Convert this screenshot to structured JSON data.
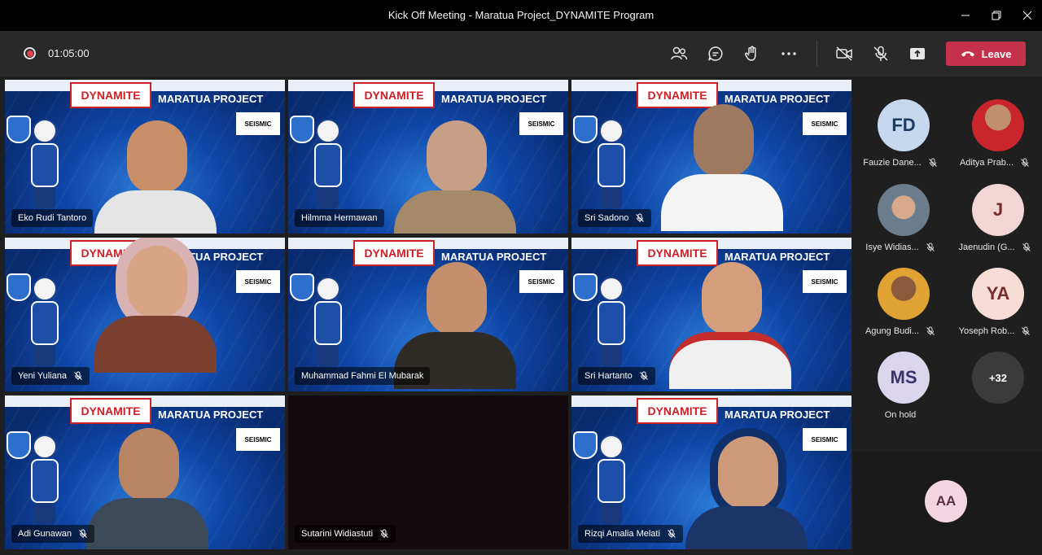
{
  "window": {
    "title": "Kick Off Meeting - Maratua Project_DYNAMITE Program"
  },
  "toolbar": {
    "timer": "01:05:00",
    "leave_label": "Leave"
  },
  "background": {
    "dynamite": "DYNAMITE",
    "project": "MARATUA PROJECT",
    "seismic": "SEISMIC"
  },
  "participants": [
    {
      "name": "Eko Rudi Tantoro",
      "muted": false
    },
    {
      "name": "Hilmma Hermawan",
      "muted": false
    },
    {
      "name": "Sri Sadono",
      "muted": true
    },
    {
      "name": "Yeni Yuliana",
      "muted": true
    },
    {
      "name": "Muhammad Fahmi El Mubarak",
      "muted": false,
      "active": true
    },
    {
      "name": "Sri Hartanto",
      "muted": true
    },
    {
      "name": "Adi Gunawan",
      "muted": true
    },
    {
      "name": "Sutarini Widiastuti",
      "muted": true,
      "video_off": true
    },
    {
      "name": "Rizqi Amalia Melati",
      "muted": true
    }
  ],
  "sidebar": {
    "people": [
      {
        "initials": "FD",
        "name": "Fauzie Dane...",
        "muted": true
      },
      {
        "initials": "",
        "name": "Aditya Prab...",
        "muted": true
      },
      {
        "initials": "",
        "name": "Isye Widias...",
        "muted": true
      },
      {
        "initials": "J",
        "name": "Jaenudin (G...",
        "muted": true
      },
      {
        "initials": "",
        "name": "Agung Budi...",
        "muted": true
      },
      {
        "initials": "YA",
        "name": "Yoseph Rob...",
        "muted": true
      },
      {
        "initials": "MS",
        "name": "On hold",
        "muted": false
      },
      {
        "initials": "+32",
        "name": "",
        "muted": false
      }
    ],
    "self_initials": "AA"
  },
  "colors": {
    "leave": "#c4314b",
    "active_outline": "#8b8cc7",
    "toolbar": "#292929"
  }
}
